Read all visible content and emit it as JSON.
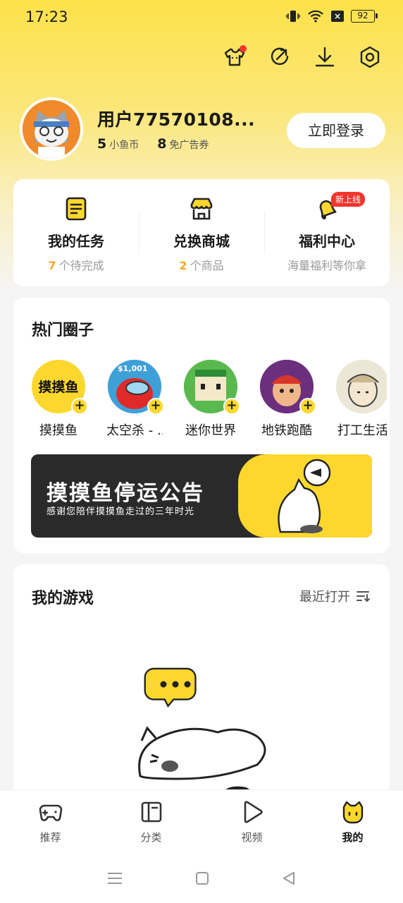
{
  "status_bar": {
    "time": "17:23",
    "battery": "92"
  },
  "profile": {
    "username": "用户77570108...",
    "coins": {
      "value": "5",
      "label": "小鱼币"
    },
    "coupons": {
      "value": "8",
      "label": "免广告券"
    },
    "login_label": "立即登录"
  },
  "quick_links": [
    {
      "title": "我的任务",
      "count": "7",
      "sub": "个待完成"
    },
    {
      "title": "兑换商城",
      "count": "2",
      "sub": "个商品"
    },
    {
      "title": "福利中心",
      "sub": "海量福利等你拿",
      "badge": "新上线"
    }
  ],
  "circles": {
    "title": "热门圈子",
    "items": [
      {
        "label": "摸摸鱼",
        "logo_text": "摸摸鱼"
      },
      {
        "label": "太空杀 - ...",
        "logo_text": "$1,001"
      },
      {
        "label": "迷你世界"
      },
      {
        "label": "地铁跑酷"
      },
      {
        "label": "打工生活"
      }
    ],
    "banner": {
      "title": "摸摸鱼停运公告",
      "subtitle": "感谢您陪伴摸摸鱼走过的三年时光"
    }
  },
  "games": {
    "title": "我的游戏",
    "sort_label": "最近打开"
  },
  "bottom_nav": [
    {
      "label": "推荐"
    },
    {
      "label": "分类"
    },
    {
      "label": "视频"
    },
    {
      "label": "我的"
    }
  ],
  "colors": {
    "accent": "#fcd72d",
    "highlight": "#f5a623",
    "badge": "#f0352d"
  }
}
